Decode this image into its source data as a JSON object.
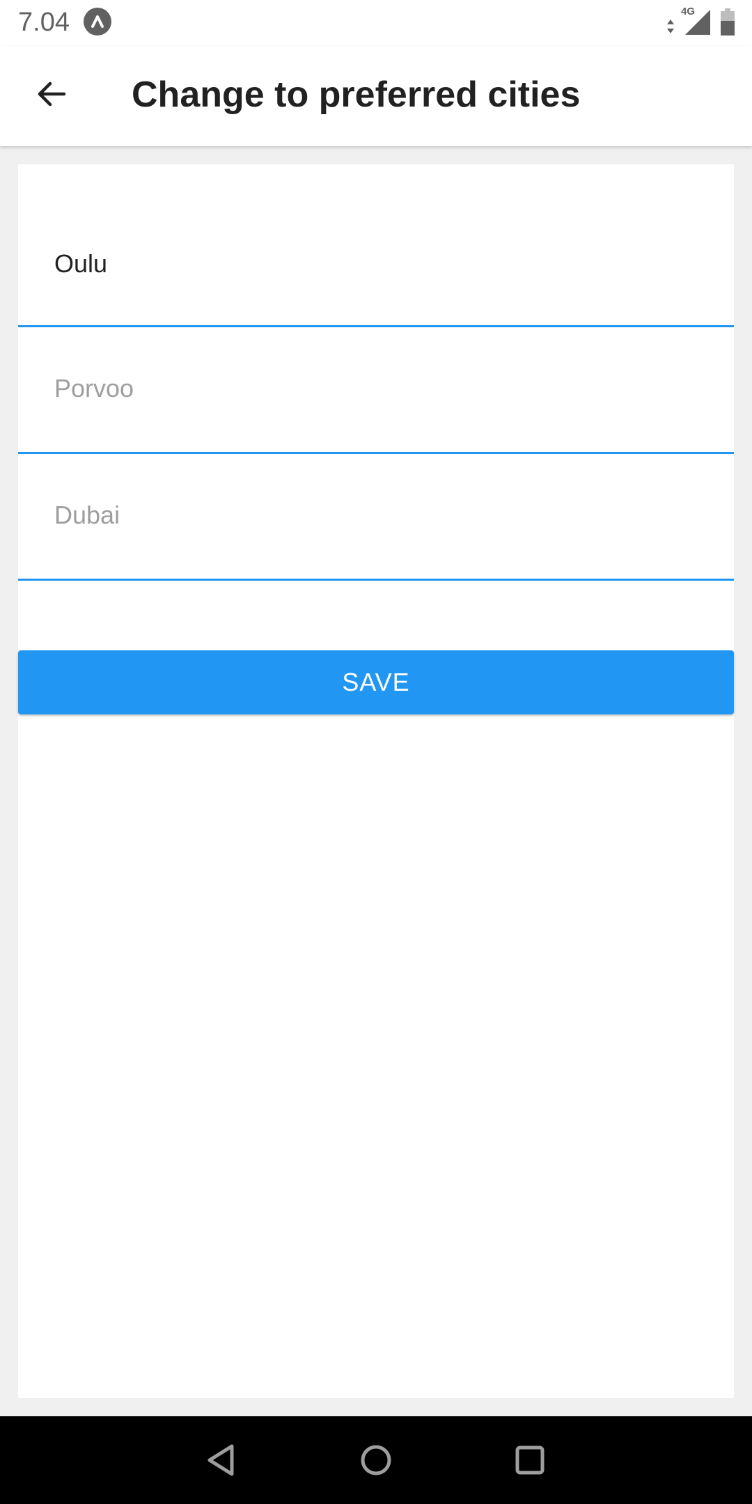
{
  "status_bar": {
    "time": "7.04",
    "network_label": "4G",
    "icons": [
      "app-notification-icon",
      "data-arrows-icon",
      "cellular-signal-icon",
      "battery-icon"
    ]
  },
  "app_bar": {
    "title": "Change to preferred cities",
    "back_icon": "arrow-back-icon"
  },
  "form": {
    "fields": [
      {
        "value": "Oulu",
        "placeholder": ""
      },
      {
        "value": "",
        "placeholder": "Porvoo"
      },
      {
        "value": "",
        "placeholder": "Dubai"
      }
    ],
    "save_label": "SAVE"
  },
  "nav_bar": {
    "icons": [
      "back-triangle-icon",
      "home-circle-icon",
      "recents-square-icon"
    ]
  },
  "colors": {
    "accent": "#2196f3",
    "background": "#f0f0f0",
    "surface": "#ffffff",
    "text": "#212121",
    "placeholder": "#9e9e9e"
  }
}
